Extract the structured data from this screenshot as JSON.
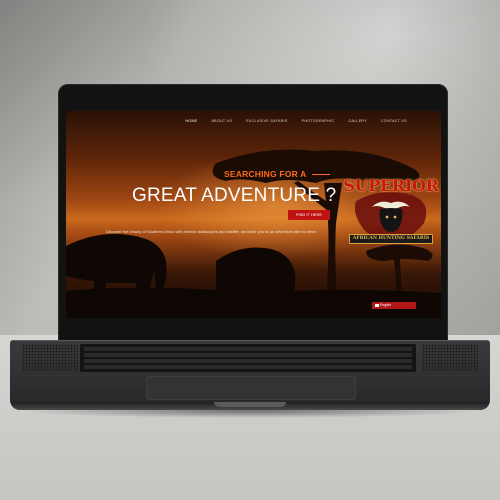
{
  "site": {
    "nav": [
      {
        "label": "HOME",
        "active": true
      },
      {
        "label": "ABOUT US",
        "active": false
      },
      {
        "label": "EXCLUSIVE SAFARIS",
        "active": false
      },
      {
        "label": "PHOTOGRAPHIC",
        "active": false
      },
      {
        "label": "GALLERY",
        "active": false
      },
      {
        "label": "CONTACT US",
        "active": false
      }
    ],
    "hero": {
      "kicker": "SEARCHING FOR A",
      "headline": "GREAT ADVENTURE ?",
      "cta_label": "FIND IT HERE",
      "tagline": "Discover the beauty of Southern Africa with diverse landscapes and wildlife, we invite you to an adventure like no other."
    },
    "logo": {
      "wordmark": "SUPERIOR",
      "subtitle": "AFRICAN HUNTING SAFARIS"
    },
    "language_selector": {
      "value": "English"
    },
    "colors": {
      "accent_orange": "#ff6a1a",
      "cta_red": "#c01212",
      "logo_red": "#c91414",
      "logo_gold": "#e6b54a"
    }
  },
  "icons": [
    "buffalo-icon",
    "flag-icon"
  ]
}
